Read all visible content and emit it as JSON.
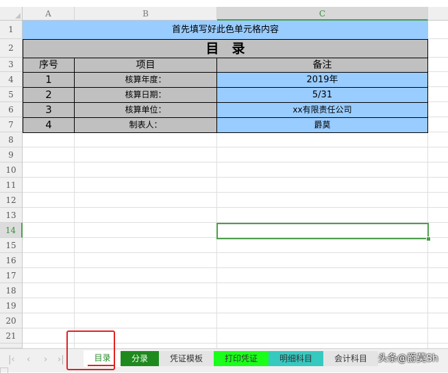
{
  "columns": [
    "A",
    "B",
    "C"
  ],
  "rows": [
    "1",
    "2",
    "3",
    "4",
    "5",
    "6",
    "7",
    "8",
    "9",
    "10",
    "11",
    "12",
    "13",
    "14",
    "15",
    "16",
    "17",
    "18",
    "19",
    "20",
    "21"
  ],
  "sheet": {
    "instruction": "首先填写好此色单元格内容",
    "title": "目　录",
    "headers": [
      "序号",
      "项目",
      "备注"
    ],
    "items": [
      {
        "no": "1",
        "item": "核算年度：",
        "note": "2019年"
      },
      {
        "no": "2",
        "item": "核算日期：",
        "note": "5/31"
      },
      {
        "no": "3",
        "item": "核算单位：",
        "note": "xx有限责任公司"
      },
      {
        "no": "4",
        "item": "制表人：",
        "note": "爵莫"
      }
    ]
  },
  "tabs": [
    {
      "label": "目录",
      "bg": "#ffffff",
      "color": "#2b8a2b"
    },
    {
      "label": "分录",
      "bg": "#1e8a1e",
      "color": "#ffffff"
    },
    {
      "label": "凭证模板",
      "bg": "#e4e4e4",
      "color": "#333333"
    },
    {
      "label": "打印凭证",
      "bg": "#1aff1a",
      "color": "#333333"
    },
    {
      "label": "明细科目",
      "bg": "#35c9c0",
      "color": "#333333"
    },
    {
      "label": "会计科目",
      "bg": "#e4e4e4",
      "color": "#333333"
    }
  ],
  "watermark": "头条@爵莫Sh",
  "colors": {
    "light_blue": "#99ccff",
    "gray": "#c0c0c0",
    "selection": "#4a9e4a"
  }
}
